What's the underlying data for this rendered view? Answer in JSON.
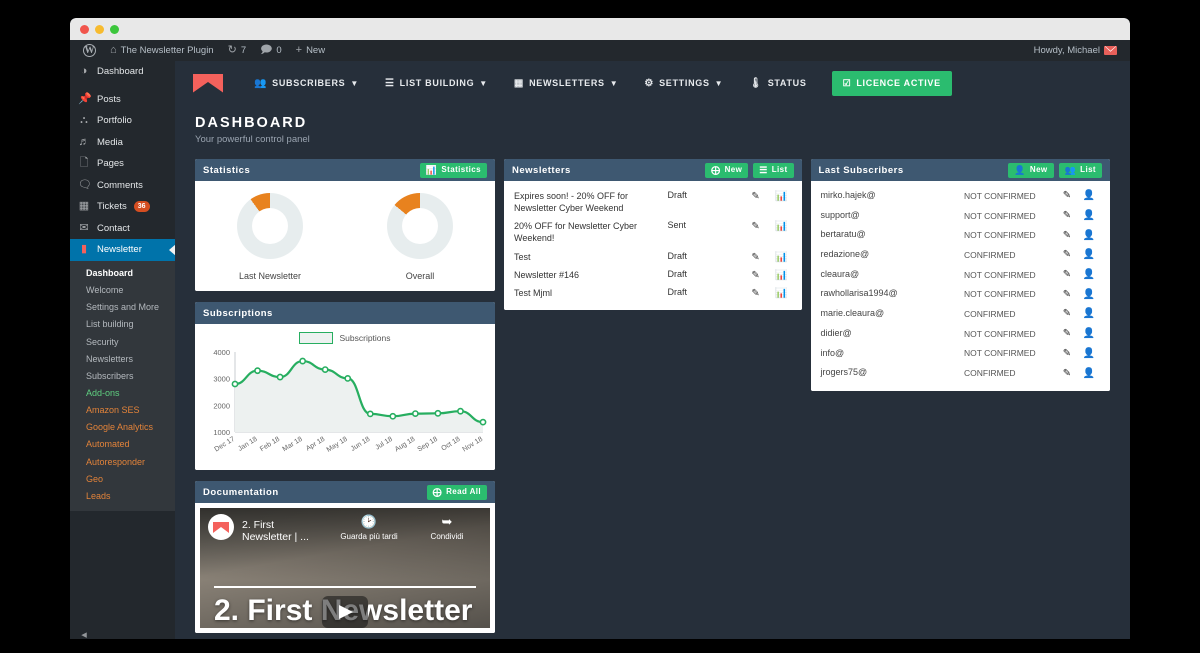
{
  "adminbar": {
    "logo_icon": "wordpress-logo-icon",
    "site_icon": "home-icon",
    "site_name": "The Newsletter Plugin",
    "updates_icon": "updates-icon",
    "updates_count": "7",
    "comments_icon": "comment-icon",
    "comments_count": "0",
    "new_icon": "plus-icon",
    "new_label": "New",
    "howdy": "Howdy, Michael"
  },
  "sidebar": {
    "items": [
      {
        "label": "Dashboard",
        "icon": "dashboard-icon"
      },
      {
        "label": "Posts",
        "icon": "pin-icon"
      },
      {
        "label": "Portfolio",
        "icon": "portfolio-icon"
      },
      {
        "label": "Media",
        "icon": "media-icon"
      },
      {
        "label": "Pages",
        "icon": "pages-icon"
      },
      {
        "label": "Comments",
        "icon": "comment-icon"
      },
      {
        "label": "Tickets",
        "icon": "tickets-icon",
        "badge": "36"
      },
      {
        "label": "Contact",
        "icon": "envelope-icon"
      },
      {
        "label": "Newsletter",
        "icon": "newsletter-envelope-icon",
        "active": true
      }
    ],
    "submenu": [
      {
        "label": "Dashboard",
        "style": "current"
      },
      {
        "label": "Welcome",
        "style": "normal"
      },
      {
        "label": "Settings and More",
        "style": "normal"
      },
      {
        "label": "List building",
        "style": "normal"
      },
      {
        "label": "Security",
        "style": "normal"
      },
      {
        "label": "Newsletters",
        "style": "normal"
      },
      {
        "label": "Subscribers",
        "style": "normal"
      },
      {
        "label": "Add-ons",
        "style": "green"
      },
      {
        "label": "Amazon SES",
        "style": "orange"
      },
      {
        "label": "Google Analytics",
        "style": "orange"
      },
      {
        "label": "Automated",
        "style": "orange"
      },
      {
        "label": "Autoresponder",
        "style": "orange"
      },
      {
        "label": "Geo",
        "style": "orange"
      },
      {
        "label": "Leads",
        "style": "orange"
      }
    ]
  },
  "nlnav": {
    "logo": "newsletter-logo-icon",
    "links": [
      {
        "label": "SUBSCRIBERS",
        "icon": "users-icon",
        "caret": "⌄"
      },
      {
        "label": "LIST BUILDING",
        "icon": "list-icon",
        "caret": "⌄"
      },
      {
        "label": "NEWSLETTERS",
        "icon": "newspaper-icon",
        "caret": "⌄"
      },
      {
        "label": "SETTINGS",
        "icon": "gear-icon",
        "caret": "⌄"
      },
      {
        "label": "STATUS",
        "icon": "thermometer-icon",
        "caret": ""
      }
    ],
    "licence_label": "LICENCE ACTIVE",
    "licence_icon": "check-square-icon",
    "licence_color": "#2bbc6f"
  },
  "page": {
    "title": "DASHBOARD",
    "subtitle": "Your powerful control panel"
  },
  "statistics": {
    "title": "Statistics",
    "button_label": "Statistics",
    "button_icon": "bar-chart-icon",
    "donut_color": "#e8821e",
    "donut_track_color": "#e7edee",
    "items": [
      {
        "label": "Last Newsletter",
        "percent": 10
      },
      {
        "label": "Overall",
        "percent": 14
      }
    ]
  },
  "subscriptions": {
    "title": "Subscriptions"
  },
  "chart_data": {
    "type": "line",
    "title": "Subscriptions",
    "legend": [
      "Subscriptions"
    ],
    "legend_position": "top-center",
    "xlabel": "",
    "ylabel": "",
    "x": [
      "Dec 17",
      "Jan 18",
      "Feb 18",
      "Mar 18",
      "Apr 18",
      "May 18",
      "Jun 18",
      "Jul 18",
      "Aug 18",
      "Sep 18",
      "Oct 18",
      "Nov 18"
    ],
    "categories": [
      "Dec 17",
      "Jan 18",
      "Feb 18",
      "Mar 18",
      "Apr 18",
      "May 18",
      "Jun 18",
      "Jul 18",
      "Aug 18",
      "Sep 18",
      "Oct 18",
      "Nov 18"
    ],
    "series": [
      {
        "name": "Subscriptions",
        "values": [
          2800,
          3300,
          3060,
          3660,
          3340,
          3010,
          1680,
          1590,
          1690,
          1700,
          1780,
          1370
        ]
      }
    ],
    "values": [
      2800,
      3300,
      3060,
      3660,
      3340,
      3010,
      1680,
      1590,
      1690,
      1700,
      1780,
      1370
    ],
    "yticks": [
      1000,
      2000,
      3000,
      4000
    ],
    "ylim": [
      1000,
      4000
    ],
    "grid": false,
    "line_color": "#27ae60",
    "fill_color": "#edf1f0"
  },
  "documentation": {
    "title": "Documentation",
    "button_label": "Read All",
    "button_icon": "plus-circle-icon",
    "video": {
      "channel_icon": "newsletter-avatar-icon",
      "title": "2. First Newsletter | ...",
      "watch_later_label": "Guarda più tardi",
      "watch_later_icon": "clock-icon",
      "share_label": "Condividi",
      "share_icon": "share-icon",
      "big_title": "2. First Newsletter",
      "play_icon": "play-icon"
    }
  },
  "newsletters": {
    "title": "Newsletters",
    "buttons": [
      {
        "label": "New",
        "icon": "plus-square-icon"
      },
      {
        "label": "List",
        "icon": "list-icon"
      }
    ],
    "rows": [
      {
        "name": "Expires soon! - 20% OFF for Newsletter Cyber Weekend",
        "status": "Draft",
        "state": "draft",
        "edit_icon": "pencil-icon",
        "stats_icon": "bar-chart-icon"
      },
      {
        "name": "20% OFF for Newsletter Cyber Weekend!",
        "status": "Sent",
        "state": "sent",
        "edit_icon": "pencil-icon",
        "stats_icon": "bar-chart-icon"
      },
      {
        "name": "Test",
        "status": "Draft",
        "state": "draft",
        "edit_icon": "pencil-icon",
        "stats_icon": "bar-chart-icon"
      },
      {
        "name": "Newsletter #146",
        "status": "Draft",
        "state": "draft",
        "edit_icon": "pencil-icon",
        "stats_icon": "bar-chart-icon"
      },
      {
        "name": "Test Mjml",
        "status": "Draft",
        "state": "draft",
        "edit_icon": "pencil-icon",
        "stats_icon": "bar-chart-icon"
      }
    ]
  },
  "subscribers": {
    "title": "Last Subscribers",
    "buttons": [
      {
        "label": "New",
        "icon": "user-plus-icon"
      },
      {
        "label": "List",
        "icon": "users-icon"
      }
    ],
    "rows": [
      {
        "email": "mirko.hajek@",
        "status": "NOT CONFIRMED",
        "edit_icon": "pencil-icon",
        "profile_icon": "user-icon"
      },
      {
        "email": "support@",
        "status": "NOT CONFIRMED",
        "edit_icon": "pencil-icon",
        "profile_icon": "user-icon"
      },
      {
        "email": "bertaratu@",
        "status": "NOT CONFIRMED",
        "edit_icon": "pencil-icon",
        "profile_icon": "user-icon"
      },
      {
        "email": "redazione@",
        "status": "CONFIRMED",
        "edit_icon": "pencil-icon",
        "profile_icon": "user-icon"
      },
      {
        "email": "cleaura@",
        "status": "NOT CONFIRMED",
        "edit_icon": "pencil-icon",
        "profile_icon": "user-icon"
      },
      {
        "email": "rawhollarisa1994@",
        "status": "NOT CONFIRMED",
        "edit_icon": "pencil-icon",
        "profile_icon": "user-icon"
      },
      {
        "email": "marie.cleaura@",
        "status": "CONFIRMED",
        "edit_icon": "pencil-icon",
        "profile_icon": "user-icon"
      },
      {
        "email": "didier@",
        "status": "NOT CONFIRMED",
        "edit_icon": "pencil-icon",
        "profile_icon": "user-icon"
      },
      {
        "email": "info@",
        "status": "NOT CONFIRMED",
        "edit_icon": "pencil-icon",
        "profile_icon": "user-icon"
      },
      {
        "email": "jrogers75@",
        "status": "CONFIRMED",
        "edit_icon": "pencil-icon",
        "profile_icon": "user-icon"
      }
    ]
  }
}
